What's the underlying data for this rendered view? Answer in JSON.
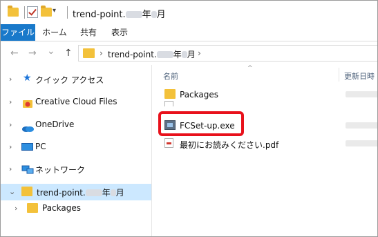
{
  "window": {
    "title_prefix": "trend-point.",
    "title_suffix": "年",
    "title_end": "月",
    "qa_dropdown": "▾"
  },
  "ribbon": {
    "tabs": [
      "ファイル",
      "ホーム",
      "共有",
      "表示"
    ]
  },
  "address": {
    "back": "←",
    "forward": "→",
    "recent": "⌄",
    "up": "↑",
    "separator1": "›",
    "crumb_prefix": "trend-point.",
    "crumb_suffix": "年",
    "crumb_end": "月",
    "separator2": "›"
  },
  "nav": {
    "items": [
      {
        "label": "クイック アクセス",
        "chevron": "›"
      },
      {
        "label": "Creative Cloud Files",
        "chevron": "›"
      },
      {
        "label": "OneDrive",
        "chevron": "›"
      },
      {
        "label": "PC",
        "chevron": "›"
      },
      {
        "label": "ネットワーク",
        "chevron": "›"
      },
      {
        "label_prefix": "trend-point.",
        "label_suffix": "年",
        "label_end": "月",
        "chevron": "⌄"
      },
      {
        "label": "Packages",
        "chevron": "›"
      }
    ]
  },
  "content": {
    "col_name": "名前",
    "col_date": "更新日時",
    "sort_indicator": "^",
    "files": [
      {
        "name": "Packages",
        "type": "folder"
      },
      {
        "name": "FCSet-up.exe",
        "type": "exe"
      },
      {
        "name": "最初にお読みください.pdf",
        "type": "pdf"
      }
    ]
  },
  "colors": {
    "file_tab": "#1979ca",
    "selection": "#cce8ff",
    "highlight": "#e8111b",
    "folder": "#f3c13a"
  }
}
